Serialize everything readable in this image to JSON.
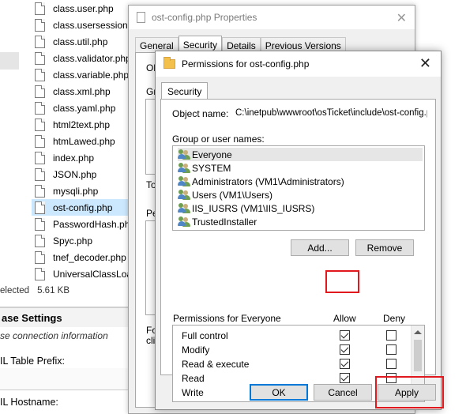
{
  "explorer": {
    "files": [
      "class.user.php",
      "class.usersession.php",
      "class.util.php",
      "class.validator.php",
      "class.variable.php",
      "class.xml.php",
      "class.yaml.php",
      "html2text.php",
      "htmLawed.php",
      "index.php",
      "JSON.php",
      "mysqli.php",
      "ost-config.php",
      "PasswordHash.php",
      "Spyc.php",
      "tnef_decoder.php",
      "UniversalClassLoader.php"
    ],
    "selected_file": "ost-config.php",
    "status_selected": "elected",
    "status_size": "5.61 KB"
  },
  "web_page": {
    "section_title": "ase Settings",
    "section_subtitle": "se connection information",
    "field1_label": "IL Table Prefix:",
    "field2_label": "IL Hostname:"
  },
  "properties_dialog": {
    "title": "ost-config.php Properties",
    "tabs": [
      "General",
      "Security",
      "Details",
      "Previous Versions"
    ],
    "active_tab": "Security",
    "fragments": [
      "Ob",
      "Gr",
      "To",
      "Pe",
      "Fo",
      "clic"
    ]
  },
  "permissions_dialog": {
    "title": "Permissions for ost-config.php",
    "close_glyph": "✕",
    "tab": "Security",
    "object_name_label": "Object name:",
    "object_name_value": "C:\\inetpub\\wwwroot\\osTicket\\include\\ost-config.php",
    "group_label": "Group or user names:",
    "groups": [
      "Everyone",
      "SYSTEM",
      "Administrators (VM1\\Administrators)",
      "Users (VM1\\Users)",
      "IIS_IUSRS (VM1\\IIS_IUSRS)",
      "TrustedInstaller"
    ],
    "selected_group": "Everyone",
    "add_button": "Add...",
    "remove_button": "Remove",
    "permissions_header": "Permissions for Everyone",
    "allow_header": "Allow",
    "deny_header": "Deny",
    "permissions": [
      {
        "name": "Full control",
        "allow": true,
        "deny": false
      },
      {
        "name": "Modify",
        "allow": true,
        "deny": false
      },
      {
        "name": "Read & execute",
        "allow": true,
        "deny": false
      },
      {
        "name": "Read",
        "allow": true,
        "deny": false
      },
      {
        "name": "Write",
        "allow": true,
        "deny": false
      }
    ],
    "ok_button": "OK",
    "cancel_button": "Cancel",
    "apply_button": "Apply"
  },
  "colors": {
    "highlight_red": "#e1181e",
    "selection_blue": "#cce8ff",
    "default_button_border": "#0078d7"
  }
}
